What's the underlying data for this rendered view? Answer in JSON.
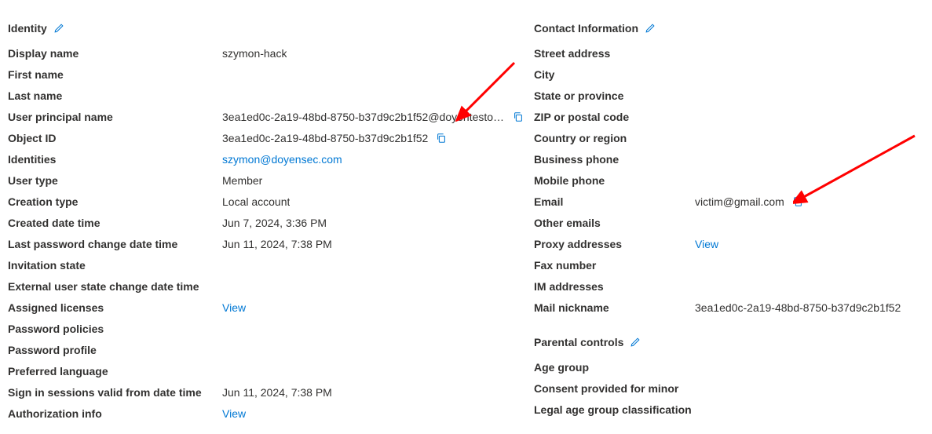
{
  "identity": {
    "header": "Identity",
    "fields": {
      "display_name": {
        "label": "Display name",
        "value": "szymon-hack"
      },
      "first_name": {
        "label": "First name",
        "value": ""
      },
      "last_name": {
        "label": "Last name",
        "value": ""
      },
      "user_principal_name": {
        "label": "User principal name",
        "value": "3ea1ed0c-2a19-48bd-8750-b37d9c2b1f52@doyentestorg.o..."
      },
      "object_id": {
        "label": "Object ID",
        "value": "3ea1ed0c-2a19-48bd-8750-b37d9c2b1f52"
      },
      "identities": {
        "label": "Identities",
        "value": "szymon@doyensec.com"
      },
      "user_type": {
        "label": "User type",
        "value": "Member"
      },
      "creation_type": {
        "label": "Creation type",
        "value": "Local account"
      },
      "created_date_time": {
        "label": "Created date time",
        "value": "Jun 7, 2024, 3:36 PM"
      },
      "last_password_change": {
        "label": "Last password change date time",
        "value": "Jun 11, 2024, 7:38 PM"
      },
      "invitation_state": {
        "label": "Invitation state",
        "value": ""
      },
      "external_user_state_change": {
        "label": "External user state change date time",
        "value": ""
      },
      "assigned_licenses": {
        "label": "Assigned licenses",
        "value": "View"
      },
      "password_policies": {
        "label": "Password policies",
        "value": ""
      },
      "password_profile": {
        "label": "Password profile",
        "value": ""
      },
      "preferred_language": {
        "label": "Preferred language",
        "value": ""
      },
      "sign_in_sessions": {
        "label": "Sign in sessions valid from date time",
        "value": "Jun 11, 2024, 7:38 PM"
      },
      "authorization_info": {
        "label": "Authorization info",
        "value": "View"
      }
    }
  },
  "contact": {
    "header": "Contact Information",
    "fields": {
      "street_address": {
        "label": "Street address",
        "value": ""
      },
      "city": {
        "label": "City",
        "value": ""
      },
      "state": {
        "label": "State or province",
        "value": ""
      },
      "zip": {
        "label": "ZIP or postal code",
        "value": ""
      },
      "country": {
        "label": "Country or region",
        "value": ""
      },
      "business_phone": {
        "label": "Business phone",
        "value": ""
      },
      "mobile_phone": {
        "label": "Mobile phone",
        "value": ""
      },
      "email": {
        "label": "Email",
        "value": "victim@gmail.com"
      },
      "other_emails": {
        "label": "Other emails",
        "value": ""
      },
      "proxy_addresses": {
        "label": "Proxy addresses",
        "value": "View"
      },
      "fax_number": {
        "label": "Fax number",
        "value": ""
      },
      "im_addresses": {
        "label": "IM addresses",
        "value": ""
      },
      "mail_nickname": {
        "label": "Mail nickname",
        "value": "3ea1ed0c-2a19-48bd-8750-b37d9c2b1f52"
      }
    }
  },
  "parental": {
    "header": "Parental controls",
    "fields": {
      "age_group": {
        "label": "Age group",
        "value": ""
      },
      "consent_minor": {
        "label": "Consent provided for minor",
        "value": ""
      },
      "legal_age_group": {
        "label": "Legal age group classification",
        "value": ""
      }
    }
  }
}
